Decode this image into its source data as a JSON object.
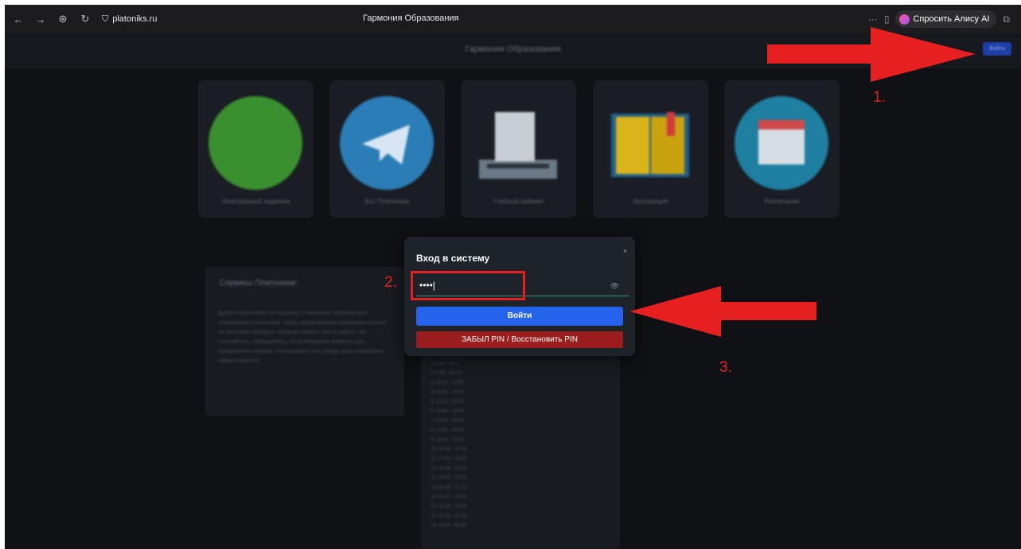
{
  "browser": {
    "url": "platoniks.ru",
    "tab_title": "Гармония Образования",
    "alice_button": "Спросить Алису AI",
    "more_label": "···"
  },
  "site": {
    "header_title": "Гармония Образования",
    "login_button": "Войти",
    "cards": [
      {
        "label": "Электронный задачник",
        "color": "#3a8f2f"
      },
      {
        "label": "Бот Платоника",
        "color": "#2a7db6"
      },
      {
        "label": "Учебный кабинет",
        "color": "#5a6a78"
      },
      {
        "label": "Инструкция",
        "color": "#c99a10"
      },
      {
        "label": "Расписание",
        "color": "#1e7fa0"
      }
    ],
    "services_title": "Сервисы Платоника!",
    "services_text": "Добро пожаловать на страницу с перечнем сервисов для сотрудников и клиентов. Здесь представлены различные ссылки на полезные ресурсы, которые помогут вам в работе. Не стесняйтесь, обращайтесь, если возникнут вопросы или понадобится помощь. Используйте этот ресурс для повышения эффективности.",
    "schedule": [
      "1: 8:30 - 9:15",
      "2: 9:25 - 10:10",
      "3: 10:20 - 11:05",
      "4: 11:15 - 12:00",
      "5: 12:10 - 12:55",
      "6: 13:05 - 13:50",
      "7: 14:00 - 14:45",
      "8: 14:55 - 15:40",
      "9: 15:50 - 16:35",
      "10: 16:45 - 17:30",
      "11: 17:40 - 18:25",
      "12: 18:35 - 19:20",
      "13: 19:30 - 20:15",
      "14: 20:25 - 21:10",
      "15: 21:20 - 22:05",
      "16: 22:15 - 23:00",
      "17: 23:10 - 23:55",
      "18: 00:05 - 00:50"
    ]
  },
  "modal": {
    "title": "Вход в систему",
    "close": "×",
    "pin_value": "••••|",
    "eye": "👁",
    "login_button": "Войти",
    "forgot_button": "ЗАБЫЛ PIN / Восстановить PIN"
  },
  "annotations": {
    "step1": "1.",
    "step2": "2.",
    "step3": "3.",
    "color": "#e62020"
  }
}
